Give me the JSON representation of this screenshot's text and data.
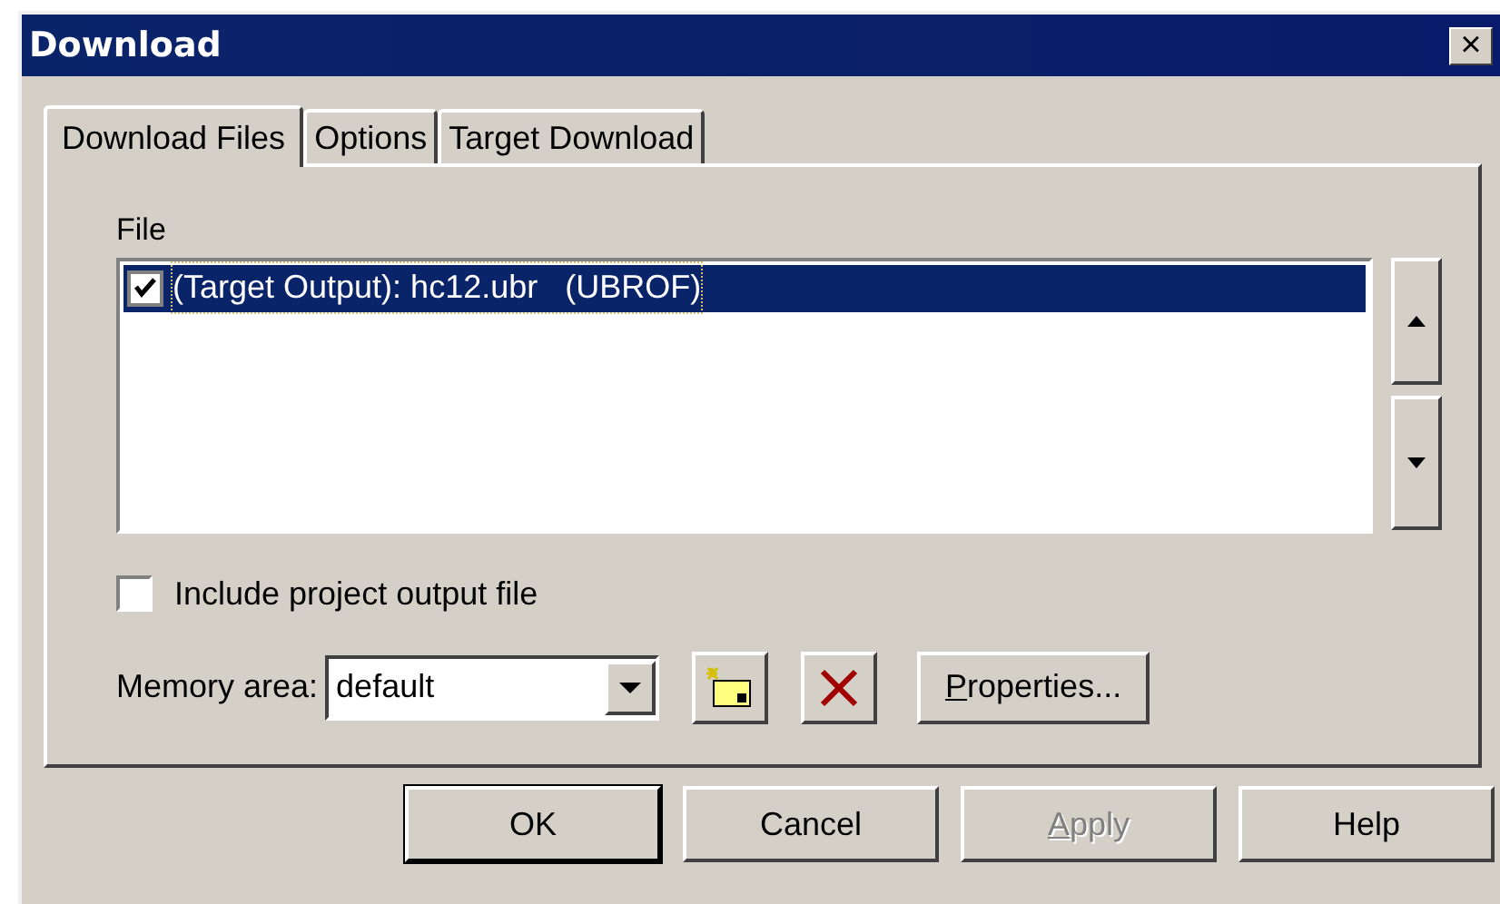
{
  "window": {
    "title": "Download",
    "close": "×"
  },
  "tabs": [
    {
      "label": "Download Files",
      "selected": true
    },
    {
      "label": "Options",
      "selected": false
    },
    {
      "label": "Target Download",
      "selected": false
    }
  ],
  "file_list": {
    "label": "File",
    "items": [
      {
        "label": "(Target Output): hc12.ubr   (UBROF)",
        "checked": true,
        "selected": true
      }
    ]
  },
  "include_project_output": {
    "label": "Include project output file",
    "checked": false
  },
  "memory_area": {
    "label": "Memory area:",
    "value": "default"
  },
  "properties_button": "Properties...",
  "buttons": [
    {
      "label": "OK",
      "default": true,
      "disabled": false
    },
    {
      "label": "Cancel",
      "default": false,
      "disabled": false
    },
    {
      "label": "Apply",
      "default": false,
      "disabled": true
    },
    {
      "label": "Help",
      "default": false,
      "disabled": false
    }
  ]
}
